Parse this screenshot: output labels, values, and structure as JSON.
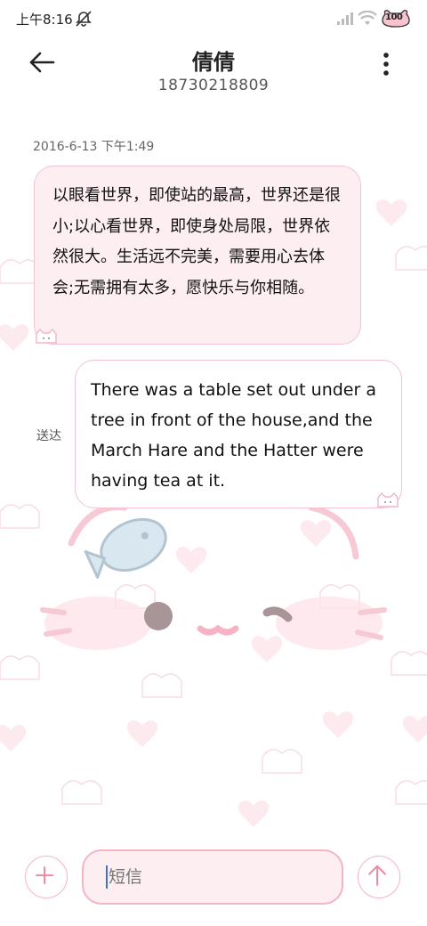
{
  "status_bar": {
    "time": "上午8:16",
    "battery": "100"
  },
  "header": {
    "contact_name": "倩倩",
    "phone_number": "18730218809"
  },
  "conversation": {
    "timestamp": "2016-6-13 下午1:49",
    "messages": [
      {
        "direction": "received",
        "text": "以眼看世界，即使站的最高，世界还是很小;以心看世界，即使身处局限，世界依然很大。生活远不完美，需要用心去体会;无需拥有太多，愿快乐与你相随。"
      },
      {
        "direction": "sent",
        "text": "There was a table set out under a tree in front of the house,and the March Hare and the Hatter were having tea at it.",
        "status": "送达"
      }
    ]
  },
  "composer": {
    "placeholder": "短信"
  },
  "icons": {
    "back": "arrow-left-icon",
    "more": "more-vertical-icon",
    "add": "plus-icon",
    "send": "arrow-up-icon",
    "mute": "bell-off-icon",
    "signal": "signal-icon",
    "wifi": "wifi-icon",
    "battery": "battery-icon"
  },
  "colors": {
    "accent_pink": "#f2b5c3",
    "bubble_received_bg": "#fdeef2",
    "cursor_blue": "#3b73d9"
  }
}
